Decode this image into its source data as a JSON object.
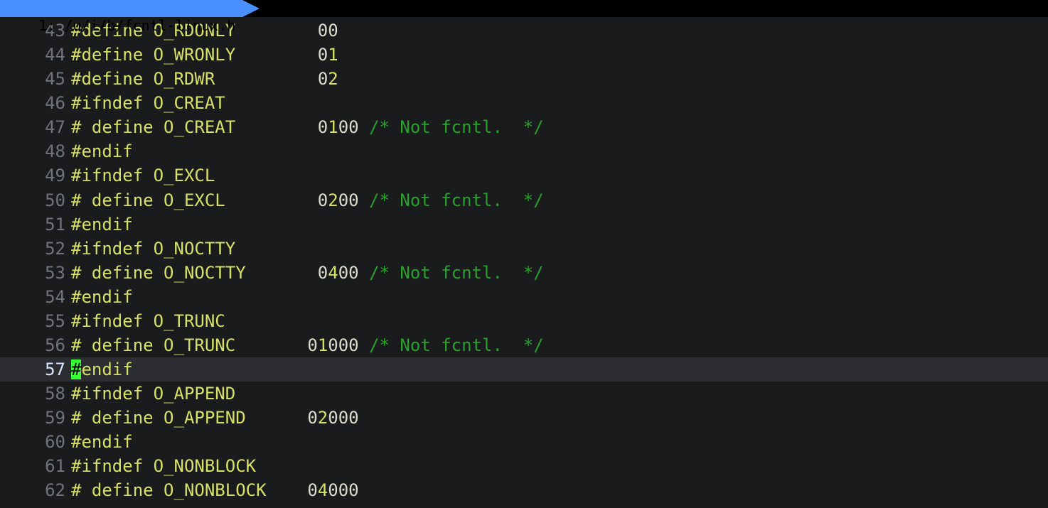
{
  "tab": {
    "index": "1",
    "path": "/u/i/b/fcntl-linux.h"
  },
  "cursor_line": 57,
  "lines": [
    {
      "n": 43,
      "segs": [
        {
          "t": "#define",
          "c": "pp"
        },
        {
          "t": " "
        },
        {
          "t": "O_RDONLY",
          "c": "id"
        },
        {
          "t": "        "
        },
        {
          "t": "00",
          "c": "z"
        }
      ]
    },
    {
      "n": 44,
      "segs": [
        {
          "t": "#define",
          "c": "pp"
        },
        {
          "t": " "
        },
        {
          "t": "O_WRONLY",
          "c": "id"
        },
        {
          "t": "        "
        },
        {
          "t": "0",
          "c": "z"
        },
        {
          "t": "1",
          "c": "nz"
        }
      ]
    },
    {
      "n": 45,
      "segs": [
        {
          "t": "#define",
          "c": "pp"
        },
        {
          "t": " "
        },
        {
          "t": "O_RDWR",
          "c": "id"
        },
        {
          "t": "          "
        },
        {
          "t": "0",
          "c": "z"
        },
        {
          "t": "2",
          "c": "nz"
        }
      ]
    },
    {
      "n": 46,
      "segs": [
        {
          "t": "#ifndef",
          "c": "pp"
        },
        {
          "t": " "
        },
        {
          "t": "O_CREAT",
          "c": "id"
        }
      ]
    },
    {
      "n": 47,
      "segs": [
        {
          "t": "# define",
          "c": "pp"
        },
        {
          "t": " "
        },
        {
          "t": "O_CREAT",
          "c": "id"
        },
        {
          "t": "        "
        },
        {
          "t": "0",
          "c": "z"
        },
        {
          "t": "1",
          "c": "nz"
        },
        {
          "t": "00",
          "c": "z"
        },
        {
          "t": " "
        },
        {
          "t": "/* Not fcntl.  */",
          "c": "cm"
        }
      ]
    },
    {
      "n": 48,
      "segs": [
        {
          "t": "#endif",
          "c": "pp"
        }
      ]
    },
    {
      "n": 49,
      "segs": [
        {
          "t": "#ifndef",
          "c": "pp"
        },
        {
          "t": " "
        },
        {
          "t": "O_EXCL",
          "c": "id"
        }
      ]
    },
    {
      "n": 50,
      "segs": [
        {
          "t": "# define",
          "c": "pp"
        },
        {
          "t": " "
        },
        {
          "t": "O_EXCL",
          "c": "id"
        },
        {
          "t": "         "
        },
        {
          "t": "0",
          "c": "z"
        },
        {
          "t": "2",
          "c": "nz"
        },
        {
          "t": "00",
          "c": "z"
        },
        {
          "t": " "
        },
        {
          "t": "/* Not fcntl.  */",
          "c": "cm"
        }
      ]
    },
    {
      "n": 51,
      "segs": [
        {
          "t": "#endif",
          "c": "pp"
        }
      ]
    },
    {
      "n": 52,
      "segs": [
        {
          "t": "#ifndef",
          "c": "pp"
        },
        {
          "t": " "
        },
        {
          "t": "O_NOCTTY",
          "c": "id"
        }
      ]
    },
    {
      "n": 53,
      "segs": [
        {
          "t": "# define",
          "c": "pp"
        },
        {
          "t": " "
        },
        {
          "t": "O_NOCTTY",
          "c": "id"
        },
        {
          "t": "       "
        },
        {
          "t": "0",
          "c": "z"
        },
        {
          "t": "4",
          "c": "nz"
        },
        {
          "t": "00",
          "c": "z"
        },
        {
          "t": " "
        },
        {
          "t": "/* Not fcntl.  */",
          "c": "cm"
        }
      ]
    },
    {
      "n": 54,
      "segs": [
        {
          "t": "#endif",
          "c": "pp"
        }
      ]
    },
    {
      "n": 55,
      "segs": [
        {
          "t": "#ifndef",
          "c": "pp"
        },
        {
          "t": " "
        },
        {
          "t": "O_TRUNC",
          "c": "id"
        }
      ]
    },
    {
      "n": 56,
      "segs": [
        {
          "t": "# define",
          "c": "pp"
        },
        {
          "t": " "
        },
        {
          "t": "O_TRUNC",
          "c": "id"
        },
        {
          "t": "       "
        },
        {
          "t": "0",
          "c": "z"
        },
        {
          "t": "1",
          "c": "nz"
        },
        {
          "t": "000",
          "c": "z"
        },
        {
          "t": " "
        },
        {
          "t": "/* Not fcntl.  */",
          "c": "cm"
        }
      ]
    },
    {
      "n": 57,
      "segs": [
        {
          "t": "#",
          "c": "cursor"
        },
        {
          "t": "endif",
          "c": "pp"
        }
      ]
    },
    {
      "n": 58,
      "segs": [
        {
          "t": "#ifndef",
          "c": "pp"
        },
        {
          "t": " "
        },
        {
          "t": "O_APPEND",
          "c": "id"
        }
      ]
    },
    {
      "n": 59,
      "segs": [
        {
          "t": "# define",
          "c": "pp"
        },
        {
          "t": " "
        },
        {
          "t": "O_APPEND",
          "c": "id"
        },
        {
          "t": "      "
        },
        {
          "t": "0",
          "c": "z"
        },
        {
          "t": "2",
          "c": "nz"
        },
        {
          "t": "000",
          "c": "z"
        }
      ]
    },
    {
      "n": 60,
      "segs": [
        {
          "t": "#endif",
          "c": "pp"
        }
      ]
    },
    {
      "n": 61,
      "segs": [
        {
          "t": "#ifndef",
          "c": "pp"
        },
        {
          "t": " "
        },
        {
          "t": "O_NONBLOCK",
          "c": "id"
        }
      ]
    },
    {
      "n": 62,
      "segs": [
        {
          "t": "# define",
          "c": "pp"
        },
        {
          "t": " "
        },
        {
          "t": "O_NONBLOCK",
          "c": "id"
        },
        {
          "t": "    "
        },
        {
          "t": "0",
          "c": "z"
        },
        {
          "t": "4",
          "c": "nz"
        },
        {
          "t": "000",
          "c": "z"
        }
      ]
    }
  ]
}
